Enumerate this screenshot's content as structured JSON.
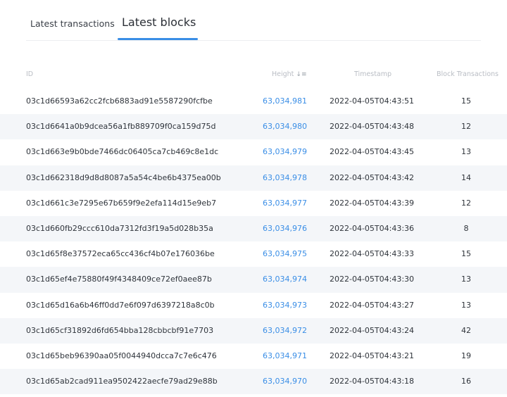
{
  "tabs": {
    "latest_transactions": "Latest transactions",
    "latest_blocks": "Latest blocks",
    "active": "latest_blocks"
  },
  "table": {
    "headers": {
      "id": "ID",
      "height": "Height",
      "timestamp": "Timestamp",
      "block_transactions": "Block Transactions"
    },
    "sort_icon": "sort-desc-icon",
    "rows": [
      {
        "id": "03c1d66593a62cc2fcb6883ad91e5587290fcfbe",
        "height": "63,034,981",
        "timestamp": "2022-04-05T04:43:51",
        "tx": "15"
      },
      {
        "id": "03c1d6641a0b9dcea56a1fb889709f0ca159d75d",
        "height": "63,034,980",
        "timestamp": "2022-04-05T04:43:48",
        "tx": "12"
      },
      {
        "id": "03c1d663e9b0bde7466dc06405ca7cb469c8e1dc",
        "height": "63,034,979",
        "timestamp": "2022-04-05T04:43:45",
        "tx": "13"
      },
      {
        "id": "03c1d662318d9d8d8087a5a54c4be6b4375ea00b",
        "height": "63,034,978",
        "timestamp": "2022-04-05T04:43:42",
        "tx": "14"
      },
      {
        "id": "03c1d661c3e7295e67b659f9e2efa114d15e9eb7",
        "height": "63,034,977",
        "timestamp": "2022-04-05T04:43:39",
        "tx": "12"
      },
      {
        "id": "03c1d660fb29ccc610da7312fd3f19a5d028b35a",
        "height": "63,034,976",
        "timestamp": "2022-04-05T04:43:36",
        "tx": "8"
      },
      {
        "id": "03c1d65f8e37572eca65cc436cf4b07e176036be",
        "height": "63,034,975",
        "timestamp": "2022-04-05T04:43:33",
        "tx": "15"
      },
      {
        "id": "03c1d65ef4e75880f49f4348409ce72ef0aee87b",
        "height": "63,034,974",
        "timestamp": "2022-04-05T04:43:30",
        "tx": "13"
      },
      {
        "id": "03c1d65d16a6b46ff0dd7e6f097d6397218a8c0b",
        "height": "63,034,973",
        "timestamp": "2022-04-05T04:43:27",
        "tx": "13"
      },
      {
        "id": "03c1d65cf31892d6fd654bba128cbbcbf91e7703",
        "height": "63,034,972",
        "timestamp": "2022-04-05T04:43:24",
        "tx": "42"
      },
      {
        "id": "03c1d65beb96390aa05f0044940dcca7c7e6c476",
        "height": "63,034,971",
        "timestamp": "2022-04-05T04:43:21",
        "tx": "19"
      },
      {
        "id": "03c1d65ab2cad911ea9502422aecfe79ad29e88b",
        "height": "63,034,970",
        "timestamp": "2022-04-05T04:43:18",
        "tx": "16"
      }
    ]
  },
  "colors": {
    "accent": "#3a8ee6",
    "row_alt_bg": "#f4f6f9",
    "header_text": "#b9bdc4"
  }
}
